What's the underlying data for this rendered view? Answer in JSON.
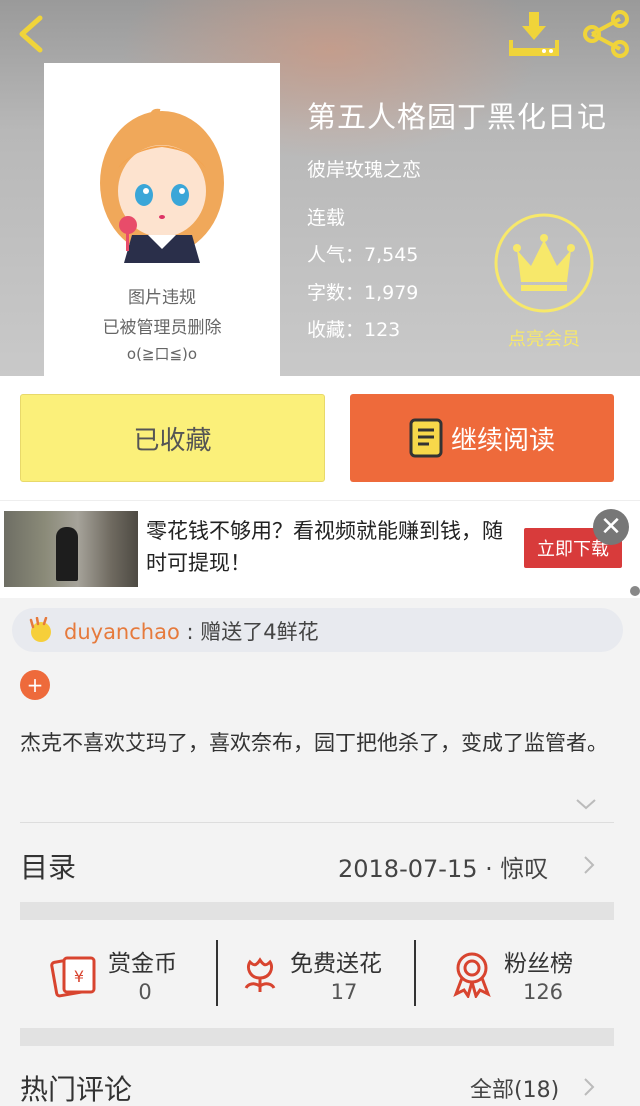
{
  "book": {
    "title": "第五人格园丁黑化日记",
    "author": "彼岸玫瑰之恋",
    "status": "连载",
    "popularity": "人气：7,545",
    "word_count": "字数：1,979",
    "favorites": "收藏：123",
    "cover_notice_1": "图片违规",
    "cover_notice_2": "已被管理员删除",
    "cover_notice_3": "o(≧口≦)o"
  },
  "vip": {
    "label": "点亮会员"
  },
  "actions": {
    "favorited_label": "已收藏",
    "continue_label": "继续阅读"
  },
  "ad": {
    "text": "零花钱不够用？看视频就能赚到钱，随时可提现！",
    "button": "立即下载",
    "close": "✕"
  },
  "gift": {
    "user": "duyanchao",
    "message": " : 赠送了4鲜花"
  },
  "add_button": "+",
  "description": "杰克不喜欢艾玛了，喜欢奈布，园丁把他杀了，变成了监管者。",
  "toc": {
    "label": "目录",
    "date": "2018-07-15 · 惊叹"
  },
  "stats": [
    {
      "label": "赏金币",
      "value": "0",
      "icon": "reward-coin-icon"
    },
    {
      "label": "免费送花",
      "value": "17",
      "icon": "flower-icon"
    },
    {
      "label": "粉丝榜",
      "value": "126",
      "icon": "medal-icon"
    }
  ],
  "comments": {
    "label": "热门评论",
    "all": "全部(18)"
  },
  "colors": {
    "accent_orange": "#ee6a3b",
    "favorite_yellow": "#fbf07a",
    "icon_yellow": "#f0d43a",
    "vip_yellow": "#f7e86a",
    "icon_red": "#d8442f"
  }
}
